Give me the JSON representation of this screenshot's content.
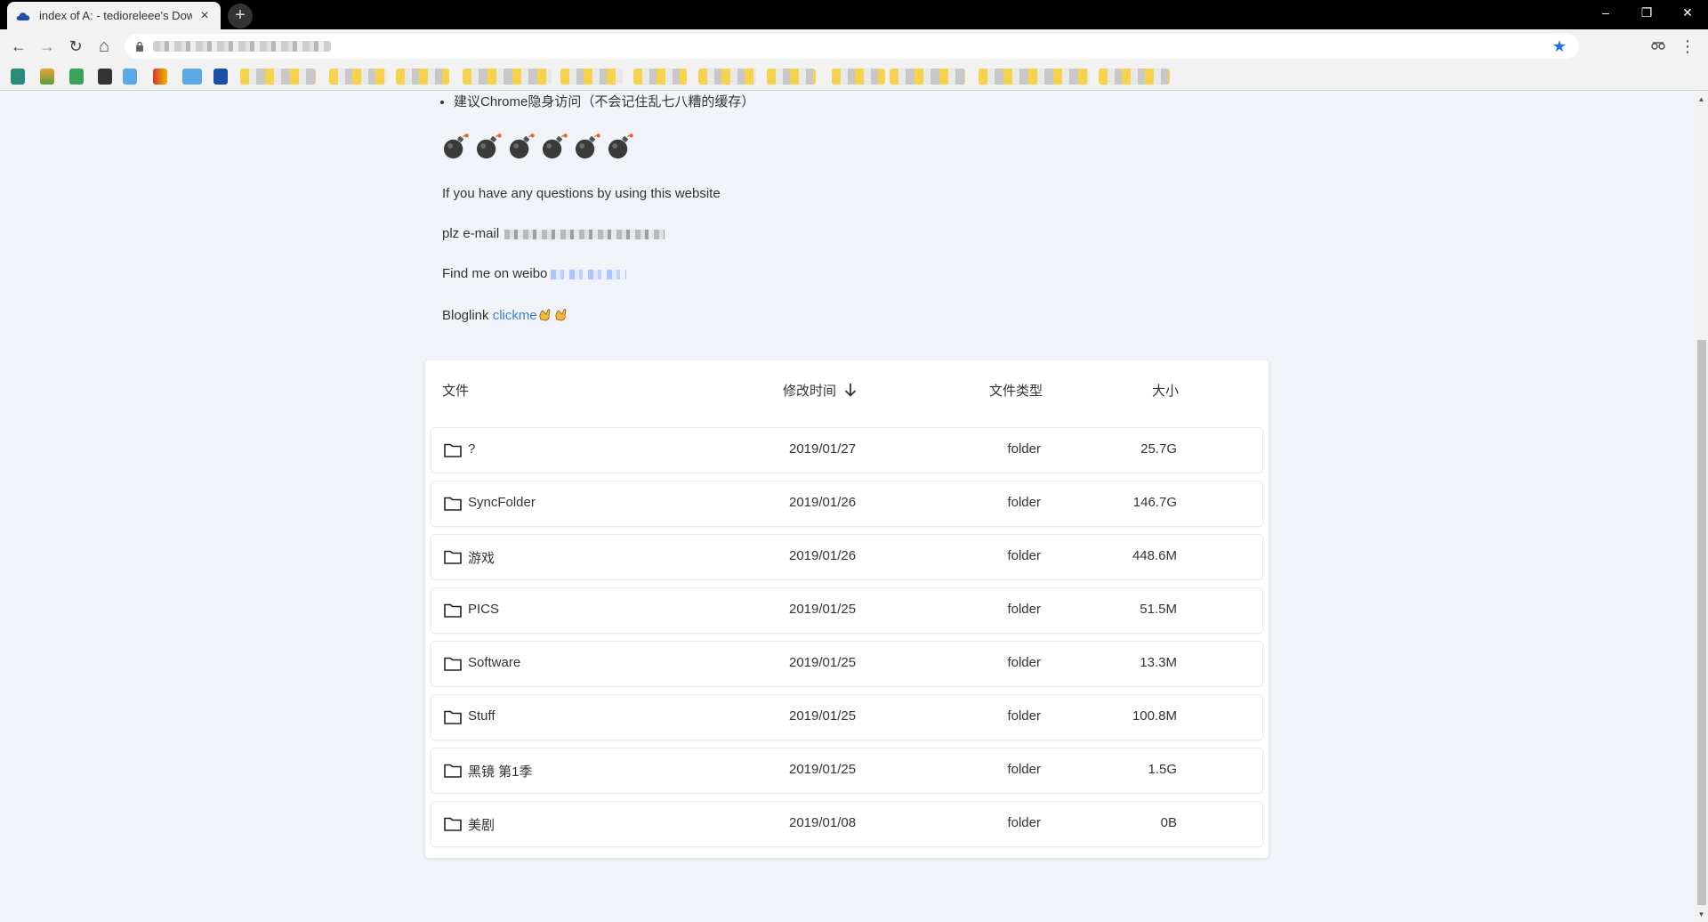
{
  "browser": {
    "tab_title": "index of A: - tedioreleee's Downl",
    "tab_close": "×",
    "new_tab": "+",
    "window_controls": {
      "minimize": "–",
      "restore": "❐",
      "close": "✕"
    },
    "nav": {
      "back": "←",
      "forward": "→",
      "reload": "↻",
      "home": "⌂"
    },
    "star": "★",
    "accent_color": "#1a73e8"
  },
  "page": {
    "notice_item": "建议Chrome隐身访问（不会记住乱七八糟的缓存）",
    "bomb_count_icons": [
      "bomb-icon",
      "bomb-icon",
      "bomb-icon",
      "bomb-icon",
      "bomb-icon",
      "bomb-icon"
    ],
    "questions_text": "If you have any questions by using this website",
    "email_label": "plz e-mail",
    "weibo_label": "Find me on weibo",
    "bloglink_label": "Bloglink",
    "bloglink_link": "clickme",
    "link_color": "#3f7ddb"
  },
  "table": {
    "headers": {
      "name": "文件",
      "modified": "修改时间",
      "type": "文件类型",
      "size": "大小"
    },
    "sort": "descending",
    "rows": [
      {
        "name": "?",
        "modified": "2019/01/27",
        "type": "folder",
        "size": "25.7G"
      },
      {
        "name": "SyncFolder",
        "modified": "2019/01/26",
        "type": "folder",
        "size": "146.7G"
      },
      {
        "name": "游戏",
        "modified": "2019/01/26",
        "type": "folder",
        "size": "448.6M"
      },
      {
        "name": "PICS",
        "modified": "2019/01/25",
        "type": "folder",
        "size": "51.5M"
      },
      {
        "name": "Software",
        "modified": "2019/01/25",
        "type": "folder",
        "size": "13.3M"
      },
      {
        "name": "Stuff",
        "modified": "2019/01/25",
        "type": "folder",
        "size": "100.8M"
      },
      {
        "name": "黑镜 第1季",
        "modified": "2019/01/25",
        "type": "folder",
        "size": "1.5G"
      },
      {
        "name": "美剧",
        "modified": "2019/01/08",
        "type": "folder",
        "size": "0B"
      }
    ]
  }
}
